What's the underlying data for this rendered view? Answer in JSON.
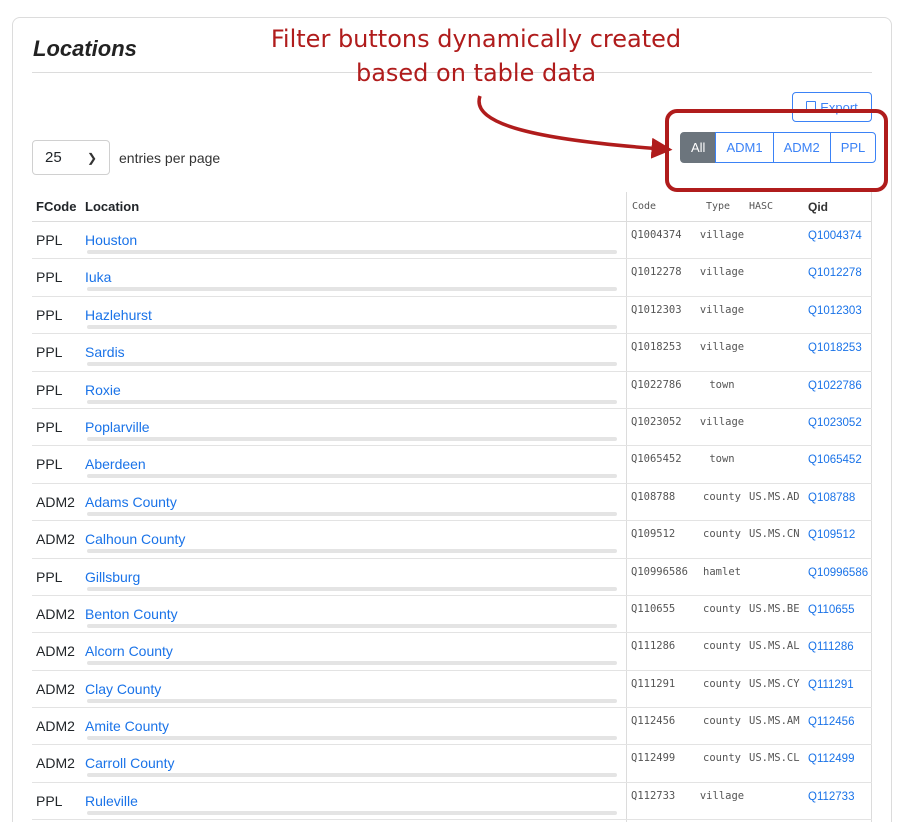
{
  "page": {
    "title": "Locations"
  },
  "annotation": {
    "text_line1": "Filter buttons dynamically created",
    "text_line2": "based on table data",
    "color": "#b01c1c"
  },
  "toolbar": {
    "export_label": "Export",
    "export_icon": "file-icon"
  },
  "filters": [
    "All",
    "ADM1",
    "ADM2",
    "PPL"
  ],
  "length_menu": {
    "value": "25",
    "label": "entries per page"
  },
  "table": {
    "headers": {
      "fcode": "FCode",
      "location": "Location",
      "code": "Code",
      "type": "Type",
      "hasc": "HASC",
      "qid": "Qid"
    },
    "rows": [
      {
        "fcode": "PPL",
        "location": "Houston",
        "code": "Q1004374",
        "type": "village",
        "hasc": "",
        "qid": "Q1004374"
      },
      {
        "fcode": "PPL",
        "location": "Iuka",
        "code": "Q1012278",
        "type": "village",
        "hasc": "",
        "qid": "Q1012278"
      },
      {
        "fcode": "PPL",
        "location": "Hazlehurst",
        "code": "Q1012303",
        "type": "village",
        "hasc": "",
        "qid": "Q1012303"
      },
      {
        "fcode": "PPL",
        "location": "Sardis",
        "code": "Q1018253",
        "type": "village",
        "hasc": "",
        "qid": "Q1018253"
      },
      {
        "fcode": "PPL",
        "location": "Roxie",
        "code": "Q1022786",
        "type": "town",
        "hasc": "",
        "qid": "Q1022786"
      },
      {
        "fcode": "PPL",
        "location": "Poplarville",
        "code": "Q1023052",
        "type": "village",
        "hasc": "",
        "qid": "Q1023052"
      },
      {
        "fcode": "PPL",
        "location": "Aberdeen",
        "code": "Q1065452",
        "type": "town",
        "hasc": "",
        "qid": "Q1065452"
      },
      {
        "fcode": "ADM2",
        "location": "Adams County",
        "code": "Q108788",
        "type": "county",
        "hasc": "US.MS.AD",
        "qid": "Q108788"
      },
      {
        "fcode": "ADM2",
        "location": "Calhoun County",
        "code": "Q109512",
        "type": "county",
        "hasc": "US.MS.CN",
        "qid": "Q109512"
      },
      {
        "fcode": "PPL",
        "location": "Gillsburg",
        "code": "Q10996586",
        "type": "hamlet",
        "hasc": "",
        "qid": "Q10996586"
      },
      {
        "fcode": "ADM2",
        "location": "Benton County",
        "code": "Q110655",
        "type": "county",
        "hasc": "US.MS.BE",
        "qid": "Q110655"
      },
      {
        "fcode": "ADM2",
        "location": "Alcorn County",
        "code": "Q111286",
        "type": "county",
        "hasc": "US.MS.AL",
        "qid": "Q111286"
      },
      {
        "fcode": "ADM2",
        "location": "Clay County",
        "code": "Q111291",
        "type": "county",
        "hasc": "US.MS.CY",
        "qid": "Q111291"
      },
      {
        "fcode": "ADM2",
        "location": "Amite County",
        "code": "Q112456",
        "type": "county",
        "hasc": "US.MS.AM",
        "qid": "Q112456"
      },
      {
        "fcode": "ADM2",
        "location": "Carroll County",
        "code": "Q112499",
        "type": "county",
        "hasc": "US.MS.CL",
        "qid": "Q112499"
      },
      {
        "fcode": "PPL",
        "location": "Ruleville",
        "code": "Q112733",
        "type": "village",
        "hasc": "",
        "qid": "Q112733"
      }
    ]
  }
}
